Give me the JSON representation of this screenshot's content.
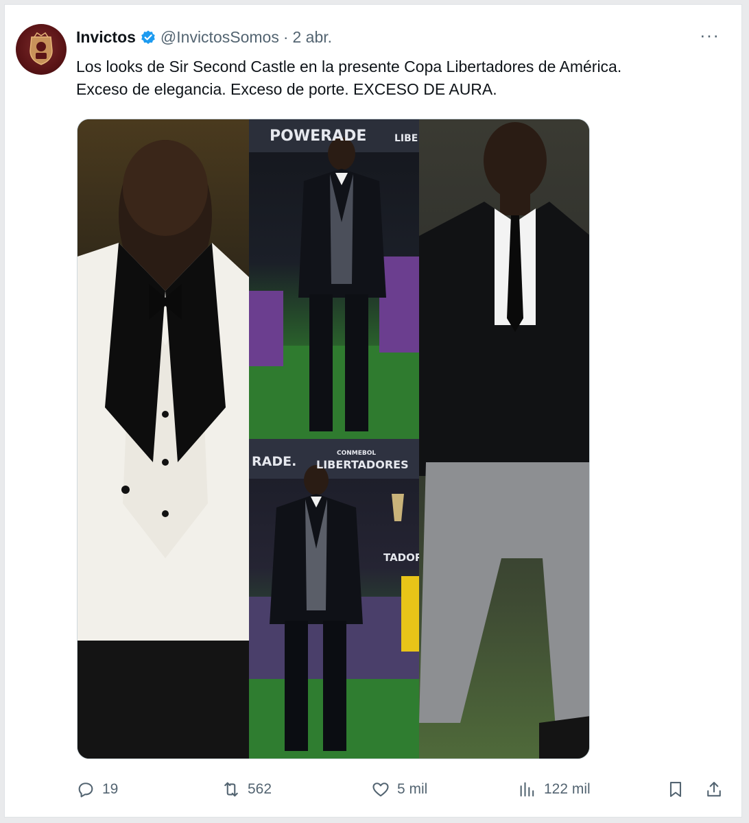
{
  "tweet": {
    "author_name": "Invictos",
    "handle": "@InvictosSomos",
    "separator": "·",
    "date": "2 abr.",
    "more_label": "···",
    "text_line1": "Los looks de Sir Second Castle en la presente Copa Libertadores de América.",
    "text_line2": "Exceso de elegancia. Exceso de porte. EXCESO DE AURA."
  },
  "media": {
    "panel2_banner_left": "POWERADE",
    "panel2_banner_right": "LIBE",
    "panel3_banner_left": "RADE.",
    "panel3_banner_small": "CONMEBOL",
    "panel3_banner_right": "LIBERTADORES",
    "panel3_side_text": "TADOR"
  },
  "actions": {
    "replies": "19",
    "retweets": "562",
    "likes": "5 mil",
    "views": "122 mil"
  },
  "colors": {
    "verified": "#1d9bf0",
    "secondary_text": "#536471",
    "primary_text": "#0f1419",
    "avatar_bg": "#5a1416"
  }
}
